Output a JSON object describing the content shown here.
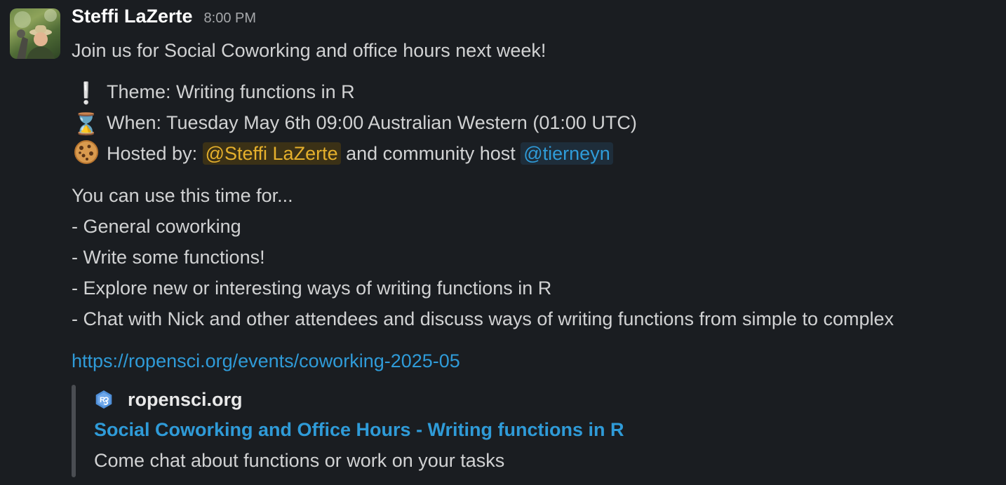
{
  "message": {
    "sender_name": "Steffi LaZerte",
    "timestamp": "8:00 PM",
    "intro": "Join us for Social Coworking and office hours next week!",
    "theme_text": "Theme: Writing functions in R",
    "when_text": "When: Tuesday May 6th 09:00 Australian Western (01:00 UTC)",
    "hosted_prefix": "Hosted by:",
    "host_mention": "@Steffi LaZerte",
    "hosted_middle": "and community host",
    "cohost_mention": "@tierneyn",
    "use_intro": "You can use this time for...",
    "use_items": [
      "- General coworking",
      "- Write some functions!",
      "- Explore new or interesting ways of writing functions in R",
      "- Chat with Nick and other attendees and discuss ways of writing functions from simple to complex"
    ],
    "link": "https://ropensci.org/events/coworking-2025-05"
  },
  "preview": {
    "site_name": "ropensci.org",
    "title": "Social Coworking and Office Hours - Writing functions in R",
    "description": "Come chat about functions or work on your tasks"
  },
  "icons": {
    "theme": "exclamation-icon",
    "when": "hourglass-icon",
    "host": "cookie-icon",
    "site": "ropensci-logo-icon"
  },
  "colors": {
    "background": "#1a1d21",
    "text": "#d1d2d3",
    "link": "#2f9bd8",
    "self_mention_bg": "#3b3116",
    "self_mention_text": "#e5b02c",
    "mention_bg": "#1e2d3a"
  }
}
